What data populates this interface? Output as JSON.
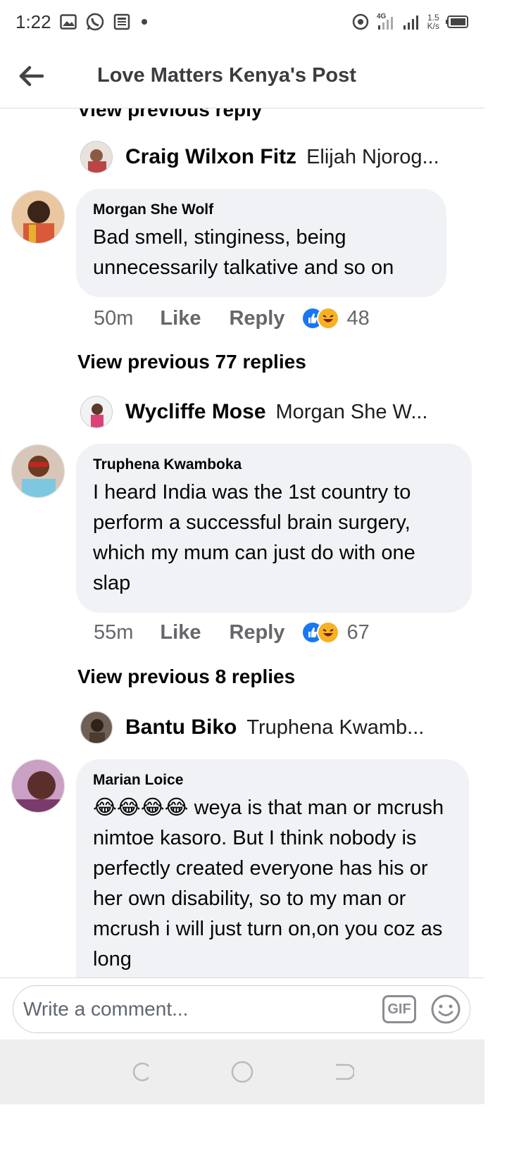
{
  "status_bar": {
    "time": "1:22",
    "network_type": "4G",
    "speed": "1.5",
    "speed_unit": "K/s"
  },
  "header": {
    "title": "Love Matters Kenya's Post"
  },
  "feed": {
    "partial_view_previous": "View previous reply",
    "threads": [
      {
        "reply_preview": {
          "name": "Craig Wilxon Fitz",
          "snippet": "Elijah Njorog..."
        },
        "comment": {
          "author": "Morgan She Wolf",
          "text": "Bad smell,  stinginess, being unnecessarily talkative and so on",
          "time": "50m",
          "like_label": "Like",
          "reply_label": "Reply",
          "reaction_count": "48"
        },
        "view_previous": "View previous 77 replies"
      },
      {
        "reply_preview": {
          "name": "Wycliffe Mose",
          "snippet": "Morgan She W..."
        },
        "comment": {
          "author": "Truphena Kwamboka",
          "text": "I heard India was the 1st country to perform a successful brain surgery, which my mum can just do with one slap",
          "time": "55m",
          "like_label": "Like",
          "reply_label": "Reply",
          "reaction_count": "67"
        },
        "view_previous": "View previous 8 replies"
      },
      {
        "reply_preview": {
          "name": "Bantu Biko",
          "snippet": "Truphena Kwamb..."
        },
        "comment": {
          "author": "Marian Loice",
          "emoji": "😂😂😂😂",
          "text": " weya is that man or mcrush nimtoe kasoro. But I think nobody is perfectly created everyone has his or her own disability, so to my man or mcrush i will just turn on,on you coz as long"
        }
      }
    ]
  },
  "composer": {
    "placeholder": "Write a comment...",
    "gif_label": "GIF"
  },
  "colors": {
    "bubble_bg": "#f0f2f5",
    "like_blue": "#1877f2",
    "haha_yellow": "#f7b125",
    "meta_gray": "#65676b"
  }
}
